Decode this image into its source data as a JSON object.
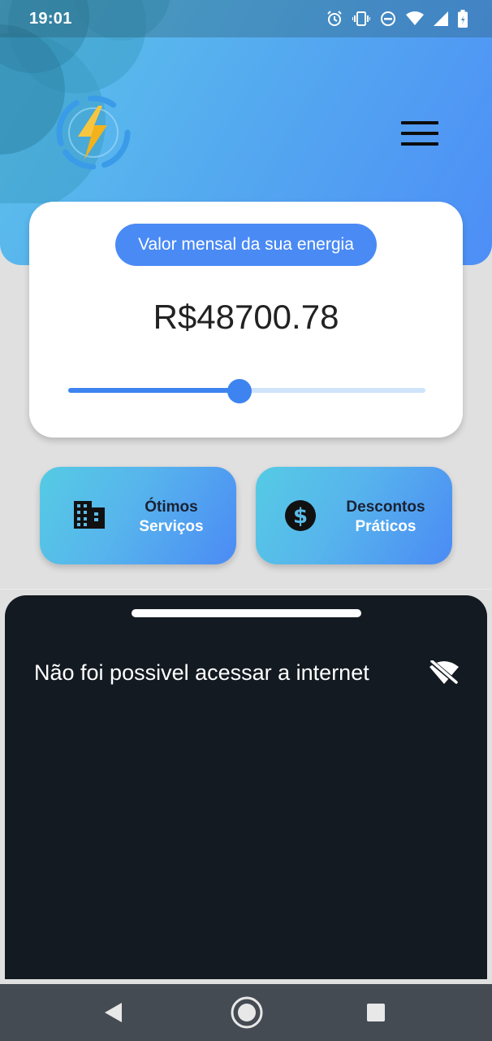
{
  "status_bar": {
    "time": "19:01",
    "icons": [
      "alarm-icon",
      "vibrate-icon",
      "do-not-disturb-icon",
      "wifi-icon",
      "signal-icon",
      "battery-icon"
    ]
  },
  "header": {
    "logo_icon": "lightning-bolt-icon",
    "menu_icon": "hamburger-menu-icon"
  },
  "value_card": {
    "label": "Valor mensal da sua energia",
    "amount": "R$48700.78",
    "slider_fraction": 0.48
  },
  "features": [
    {
      "icon": "building-icon",
      "line1": "Ótimos",
      "line2": "Serviços"
    },
    {
      "icon": "dollar-icon",
      "line1": "Descontos",
      "line2": "Práticos"
    }
  ],
  "sheet": {
    "message": "Não foi possivel acessar a internet",
    "icon": "wifi-off-icon"
  },
  "nav": {
    "back_icon": "back-icon",
    "home_icon": "home-icon",
    "recent_icon": "recent-apps-icon"
  },
  "colors": {
    "accent": "#4a8af4",
    "sheet_bg": "#131a21",
    "header_gradient_start": "#5ec5ea",
    "header_gradient_end": "#4d8ef7"
  }
}
